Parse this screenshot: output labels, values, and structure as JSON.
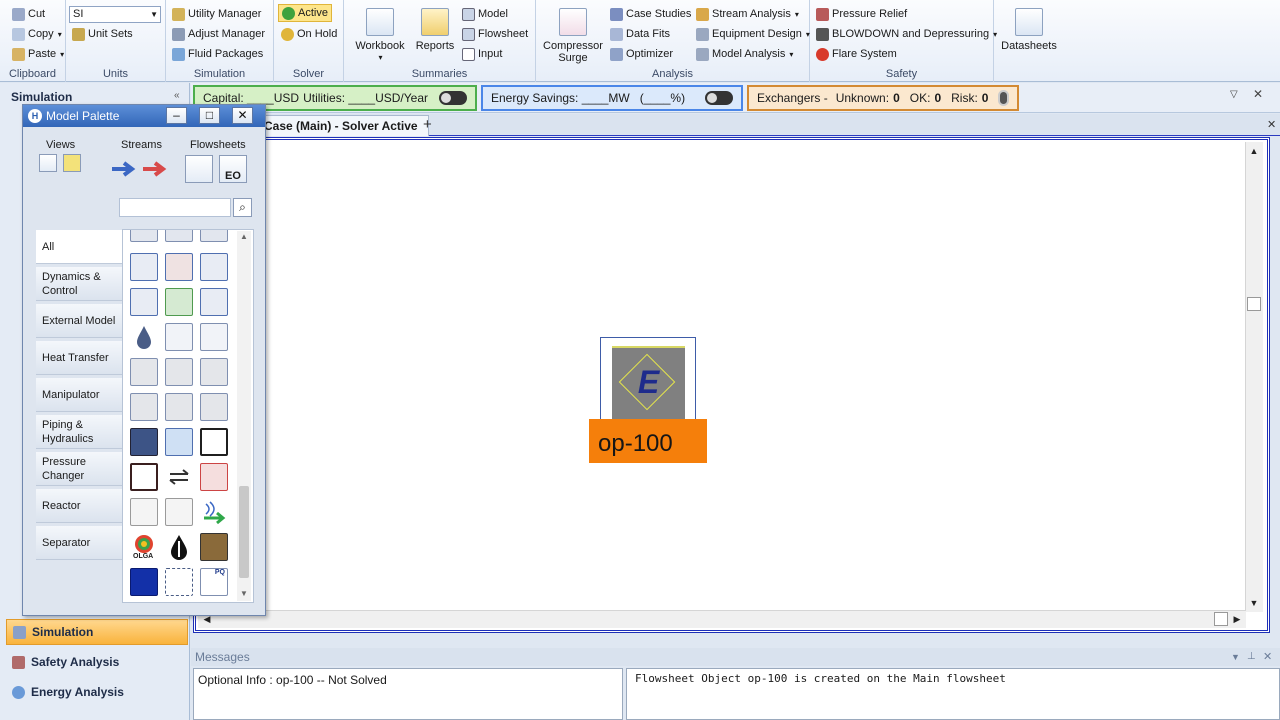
{
  "ribbon": {
    "clipboard": {
      "title": "Clipboard",
      "cut": "Cut",
      "copy": "Copy",
      "paste": "Paste"
    },
    "units": {
      "title": "Units",
      "selected": "SI",
      "unit_sets": "Unit Sets"
    },
    "simulation": {
      "title": "Simulation",
      "utility_manager": "Utility Manager",
      "adjust_manager": "Adjust Manager",
      "fluid_packages": "Fluid Packages"
    },
    "solver": {
      "title": "Solver",
      "active": "Active",
      "on_hold": "On Hold"
    },
    "summaries": {
      "title": "Summaries",
      "workbook": "Workbook",
      "reports": "Reports",
      "model": "Model",
      "flowsheet": "Flowsheet",
      "input": "Input"
    },
    "analysis": {
      "title": "Analysis",
      "compressor_1": "Compressor",
      "compressor_2": "Surge",
      "case_studies": "Case Studies",
      "data_fits": "Data Fits",
      "optimizer": "Optimizer",
      "stream_analysis": "Stream Analysis",
      "equipment_design": "Equipment Design",
      "model_analysis": "Model Analysis"
    },
    "safety": {
      "title": "Safety",
      "pressure_relief": "Pressure Relief",
      "blowdown": "BLOWDOWN and Depressuring",
      "flare_system": "Flare System"
    },
    "datasheets": {
      "label": "Datasheets"
    }
  },
  "left_pane": {
    "title": "Simulation",
    "nav": [
      {
        "label": "Simulation"
      },
      {
        "label": "Safety Analysis"
      },
      {
        "label": "Energy Analysis"
      }
    ]
  },
  "indicators": {
    "capital": "Capital: ____USD",
    "utilities": "Utilities: ____USD/Year",
    "energy": "Energy Savings: ____MW",
    "energy_pct": "(____%)",
    "exchangers": "Exchangers -",
    "unknown_label": "Unknown:",
    "unknown_value": "0",
    "ok_label": "OK:",
    "ok_value": "0",
    "risk_label": "Risk:",
    "risk_value": "0"
  },
  "tabs": {
    "active": "Case (Main) - Solver Active",
    "add": "+"
  },
  "canvas": {
    "object": {
      "letter": "E",
      "label": "op-100"
    }
  },
  "messages": {
    "title": "Messages",
    "left": "Optional Info : op-100 -- Not Solved",
    "right": "Flowsheet Object op-100 is created on the Main flowsheet"
  },
  "palette": {
    "title": "Model Palette",
    "views": "Views",
    "streams": "Streams",
    "flowsheets": "Flowsheets",
    "eo": "EO",
    "categories": [
      {
        "label": "All"
      },
      {
        "label": "Dynamics & Control"
      },
      {
        "label": "External Model"
      },
      {
        "label": "Heat Transfer"
      },
      {
        "label": "Manipulator"
      },
      {
        "label": "Piping & Hydraulics"
      },
      {
        "label": "Pressure Changer"
      },
      {
        "label": "Reactor"
      },
      {
        "label": "Separator"
      }
    ],
    "olga": "OLGA",
    "pq": "PQ"
  },
  "colors": {
    "accent": "#1d2fb8",
    "capital_border": "#4cae4c",
    "energy_border": "#4a86e8",
    "exchanger_border": "#d38a33",
    "object_label": "#f57f0b"
  }
}
